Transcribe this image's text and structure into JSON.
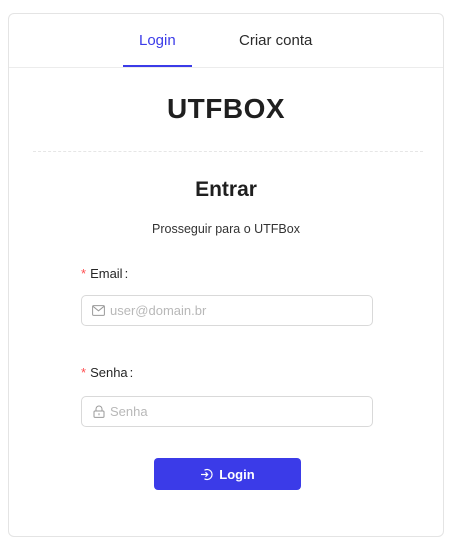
{
  "tabs": [
    {
      "label": "Login",
      "active": true
    },
    {
      "label": "Criar conta",
      "active": false
    }
  ],
  "brand": {
    "title": "UTFBOX"
  },
  "form": {
    "heading": "Entrar",
    "subheading": "Prosseguir para o UTFBox",
    "email": {
      "required_mark": "*",
      "label": "Email",
      "colon": ":",
      "placeholder": "user@domain.br",
      "value": "",
      "icon": "mail-icon"
    },
    "senha": {
      "required_mark": "*",
      "label": "Senha",
      "colon": ":",
      "placeholder": "Senha",
      "value": "",
      "icon": "lock-icon"
    },
    "submit": {
      "label": "Login",
      "icon": "login-icon"
    }
  },
  "colors": {
    "accent": "#3b3be8",
    "required": "#ff4d4f",
    "border": "#d9d9d9"
  }
}
